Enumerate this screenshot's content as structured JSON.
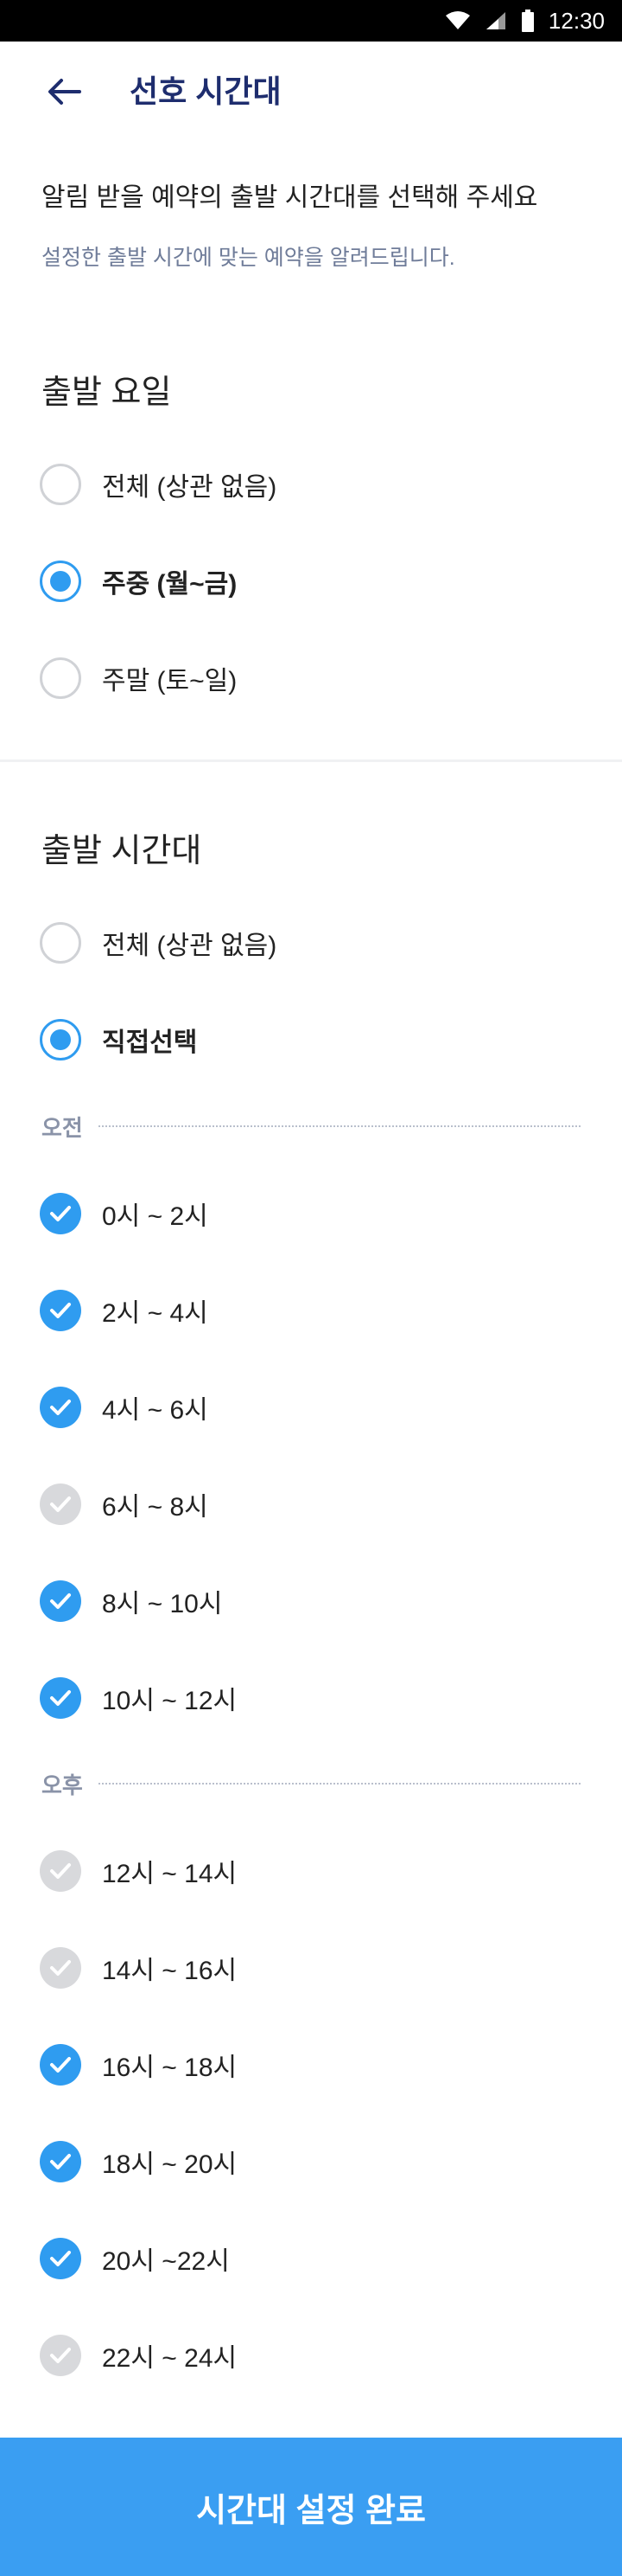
{
  "status": {
    "time": "12:30"
  },
  "header": {
    "title": "선호 시간대"
  },
  "intro": {
    "title": "알림 받을 예약의 출발 시간대를 선택해 주세요",
    "subtitle": "설정한 출발 시간에 맞는 예약을 알려드립니다."
  },
  "day_section": {
    "title": "출발 요일",
    "options": [
      {
        "label": "전체 (상관 없음)",
        "selected": false
      },
      {
        "label": "주중 (월~금)",
        "selected": true
      },
      {
        "label": "주말 (토~일)",
        "selected": false
      }
    ]
  },
  "time_section": {
    "title": "출발 시간대",
    "options": [
      {
        "label": "전체 (상관 없음)",
        "selected": false
      },
      {
        "label": "직접선택",
        "selected": true
      }
    ],
    "am": {
      "label": "오전",
      "slots": [
        {
          "label": "0시 ~ 2시",
          "checked": true
        },
        {
          "label": "2시 ~ 4시",
          "checked": true
        },
        {
          "label": "4시 ~ 6시",
          "checked": true
        },
        {
          "label": "6시 ~ 8시",
          "checked": false
        },
        {
          "label": "8시 ~ 10시",
          "checked": true
        },
        {
          "label": "10시 ~ 12시",
          "checked": true
        }
      ]
    },
    "pm": {
      "label": "오후",
      "slots": [
        {
          "label": "12시 ~ 14시",
          "checked": false
        },
        {
          "label": "14시 ~ 16시",
          "checked": false
        },
        {
          "label": "16시 ~ 18시",
          "checked": true
        },
        {
          "label": "18시 ~ 20시",
          "checked": true
        },
        {
          "label": "20시 ~22시",
          "checked": true
        },
        {
          "label": "22시 ~ 24시",
          "checked": false
        }
      ]
    }
  },
  "footer": {
    "button_label": "시간대 설정 완료"
  },
  "colors": {
    "accent": "#2f9cf0",
    "cta": "#3a9ef2",
    "title": "#1e2d6e",
    "unchecked": "#d8d9dc"
  }
}
